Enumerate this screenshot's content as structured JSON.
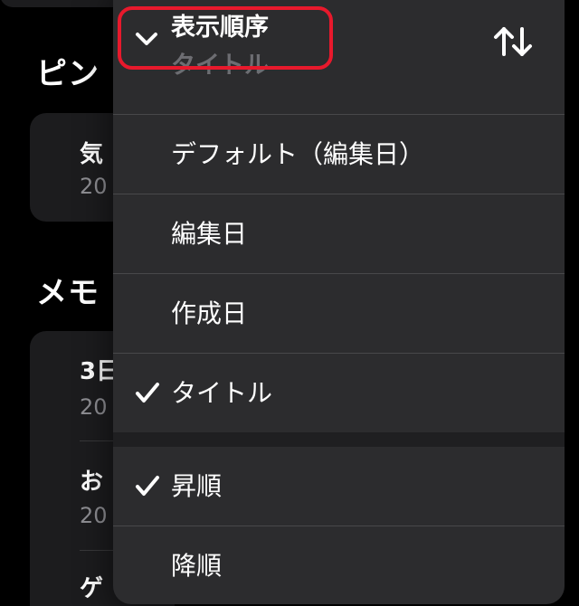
{
  "background": {
    "pinned_section_heading": "ピン",
    "pinned_note": {
      "title": "気",
      "date": "20"
    },
    "notes_section_heading": "メモ",
    "notes": [
      {
        "title": "3日",
        "date": "20"
      },
      {
        "title": "お",
        "date": "20"
      },
      {
        "title": "ゲ"
      }
    ]
  },
  "menu": {
    "header": {
      "title": "表示順序",
      "current_value": "タイトル",
      "expand_icon": "chevron-down-icon",
      "sort_icon": "arrow-up-down-icon"
    },
    "sort_by_options": [
      {
        "label": "デフォルト（編集日）",
        "checked": false
      },
      {
        "label": "編集日",
        "checked": false
      },
      {
        "label": "作成日",
        "checked": false
      },
      {
        "label": "タイトル",
        "checked": true
      }
    ],
    "order_options": [
      {
        "label": "昇順",
        "checked": true
      },
      {
        "label": "降順",
        "checked": false
      }
    ]
  },
  "colors": {
    "menu_background": "#2c2c2e",
    "highlight_outline": "#e8192c",
    "secondary_text": "#6d6d72"
  }
}
